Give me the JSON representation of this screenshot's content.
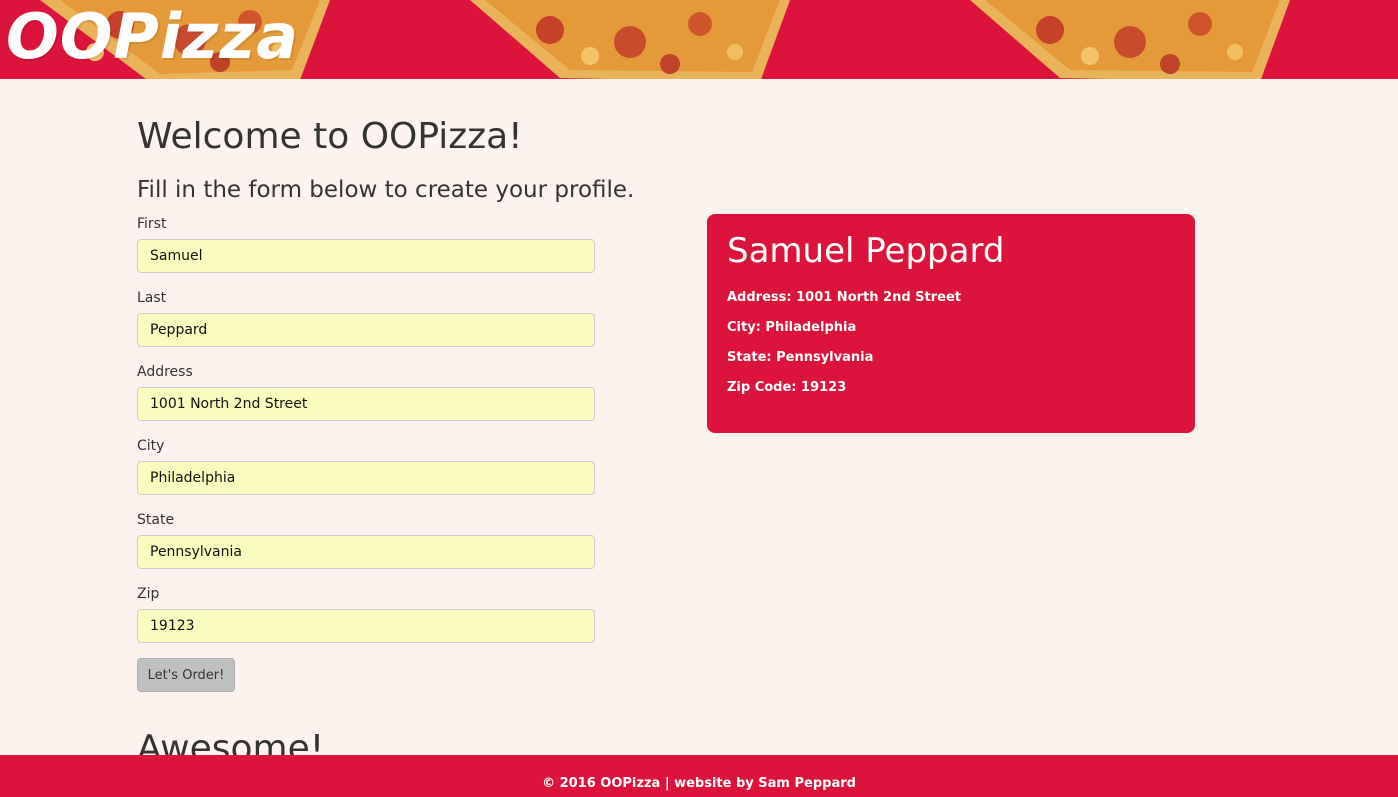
{
  "header": {
    "logo_text": "OOPizza",
    "background_color": "#dc143c",
    "decoration": "pizza-slice-images"
  },
  "main": {
    "title": "Welcome to OOPizza!",
    "subtitle": "Fill in the form below to create your profile.",
    "fields": [
      {
        "label": "First",
        "value": "Samuel"
      },
      {
        "label": "Last",
        "value": "Peppard"
      },
      {
        "label": "Address",
        "value": "1001 North 2nd Street"
      },
      {
        "label": "City",
        "value": "Philadelphia"
      },
      {
        "label": "State",
        "value": "Pennsylvania"
      },
      {
        "label": "Zip",
        "value": "19123"
      }
    ],
    "submit_label": "Let's Order!",
    "after_heading": "Awesome!"
  },
  "profile_card": {
    "name": "Samuel Peppard",
    "address_line": "Address: 1001 North 2nd Street",
    "city_line": "City: Philadelphia",
    "state_line": "State: Pennsylvania",
    "zip_line": "Zip Code: 19123",
    "background_color": "#dc143c"
  },
  "footer": {
    "text": "© 2016 OOPizza | website by Sam Peppard"
  },
  "colors": {
    "page_background": "#fdf3ee",
    "input_background": "#fafdbe",
    "button_background": "#c0c0c0",
    "accent": "#dc143c"
  }
}
